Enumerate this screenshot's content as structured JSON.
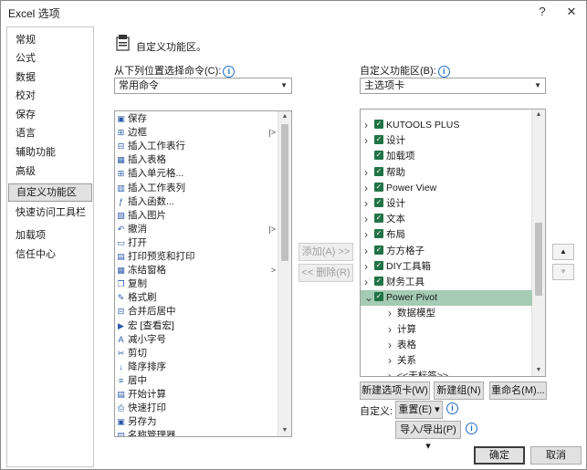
{
  "window": {
    "title": "Excel 选项",
    "help_label": "?",
    "close_label": "✕"
  },
  "nav": {
    "items": [
      {
        "label": "常规"
      },
      {
        "label": "公式"
      },
      {
        "label": "数据"
      },
      {
        "label": "校对"
      },
      {
        "label": "保存"
      },
      {
        "label": "语言"
      },
      {
        "label": "辅助功能"
      },
      {
        "label": "高级"
      },
      {
        "label": "自定义功能区",
        "selected": true
      },
      {
        "label": "快速访问工具栏"
      },
      {
        "label": "加载项"
      },
      {
        "label": "信任中心"
      }
    ]
  },
  "section": {
    "title": "自定义功能区。",
    "icon": "ribbon-customize-icon"
  },
  "left": {
    "label": "从下列位置选择命令(C):",
    "combo_value": "常用命令",
    "commands": [
      {
        "label": "保存",
        "icon": "save-icon",
        "glyph": "▣"
      },
      {
        "label": "边框",
        "icon": "border-icon",
        "glyph": "⊞",
        "split": "|>"
      },
      {
        "label": "插入工作表行",
        "icon": "insert-row-icon",
        "glyph": "⊟"
      },
      {
        "label": "插入表格",
        "icon": "insert-table-icon",
        "glyph": "▦"
      },
      {
        "label": "插入单元格...",
        "icon": "insert-cell-icon",
        "glyph": "⊞"
      },
      {
        "label": "插入工作表列",
        "icon": "insert-column-icon",
        "glyph": "▥"
      },
      {
        "label": "插入函数...",
        "icon": "function-icon",
        "glyph": "ƒ"
      },
      {
        "label": "插入图片",
        "icon": "picture-icon",
        "glyph": "▨"
      },
      {
        "label": "撤消",
        "icon": "undo-icon",
        "glyph": "↶",
        "split": "|>"
      },
      {
        "label": "打开",
        "icon": "open-folder-icon",
        "glyph": "▭"
      },
      {
        "label": "打印预览和打印",
        "icon": "print-preview-icon",
        "glyph": "▤"
      },
      {
        "label": "冻结窗格",
        "icon": "freeze-panes-icon",
        "glyph": "▦",
        "split": ">"
      },
      {
        "label": "复制",
        "icon": "copy-icon",
        "glyph": "❐"
      },
      {
        "label": "格式刷",
        "icon": "format-painter-icon",
        "glyph": "✎"
      },
      {
        "label": "合并后居中",
        "icon": "merge-center-icon",
        "glyph": "⊟"
      },
      {
        "label": "宏 [查看宏]",
        "icon": "macro-icon",
        "glyph": "▶"
      },
      {
        "label": "减小字号",
        "icon": "decrease-font-icon",
        "glyph": "A"
      },
      {
        "label": "剪切",
        "icon": "cut-icon",
        "glyph": "✂"
      },
      {
        "label": "降序排序",
        "icon": "sort-descending-icon",
        "glyph": "↓"
      },
      {
        "label": "居中",
        "icon": "center-align-icon",
        "glyph": "≡"
      },
      {
        "label": "开始计算",
        "icon": "calculate-icon",
        "glyph": "▤"
      },
      {
        "label": "快速打印",
        "icon": "quick-print-icon",
        "glyph": "⎙"
      },
      {
        "label": "另存为",
        "icon": "save-as-icon",
        "glyph": "▣"
      },
      {
        "label": "名称管理器",
        "icon": "name-manager-icon",
        "glyph": "▤"
      }
    ]
  },
  "mid": {
    "add_label": "添加(A) >>",
    "remove_label": "<< 删除(R)"
  },
  "right": {
    "label": "自定义功能区(B):",
    "combo_value": "主选项卡",
    "tabs": [
      {
        "label": "KUTOOLS PLUS",
        "level": 0,
        "checked": true
      },
      {
        "label": "设计",
        "level": 0,
        "checked": true
      },
      {
        "label": "加载项",
        "level": 0,
        "checked": true,
        "noexp": true
      },
      {
        "label": "帮助",
        "level": 0,
        "checked": true
      },
      {
        "label": "Power View",
        "level": 0,
        "checked": true
      },
      {
        "label": "设计",
        "level": 0,
        "checked": true
      },
      {
        "label": "文本",
        "level": 0,
        "checked": true
      },
      {
        "label": "布局",
        "level": 0,
        "checked": true
      },
      {
        "label": "方方格子",
        "level": 0,
        "checked": true
      },
      {
        "label": "DIY工具箱",
        "level": 0,
        "checked": true
      },
      {
        "label": "财务工具",
        "level": 0,
        "checked": true
      },
      {
        "label": "Power Pivot",
        "level": 0,
        "checked": true,
        "selected": true,
        "expanded": true
      },
      {
        "label": "数据模型",
        "level": 1
      },
      {
        "label": "计算",
        "level": 1
      },
      {
        "label": "表格",
        "level": 1
      },
      {
        "label": "关系",
        "level": 1
      },
      {
        "label": "<<无标签>>",
        "level": 1
      }
    ],
    "new_tab_label": "新建选项卡(W)",
    "new_group_label": "新建组(N)",
    "rename_label": "重命名(M)...",
    "customize_label": "自定义:",
    "reset_label": "重置(E) ▾",
    "import_export_label": "导入/导出(P) ▾",
    "move_up": "▲",
    "move_down": "▼"
  },
  "footer": {
    "ok_label": "确定",
    "cancel_label": "取消"
  }
}
